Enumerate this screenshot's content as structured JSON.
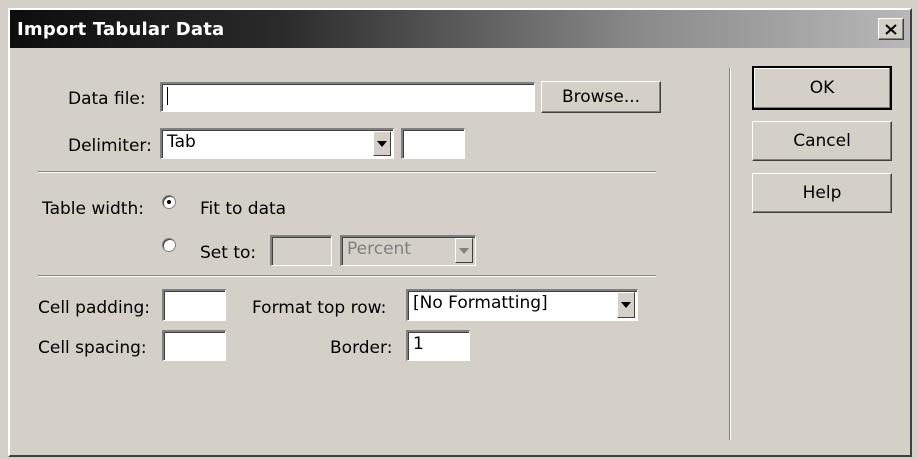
{
  "window": {
    "title": "Import Tabular Data",
    "close_label": "×"
  },
  "form": {
    "data_file": {
      "label": "Data file:",
      "value": "",
      "browse_label": "Browse..."
    },
    "delimiter": {
      "label": "Delimiter:",
      "selected": "Tab",
      "other_value": ""
    },
    "table_width": {
      "label": "Table width:",
      "fit_label": "Fit to data",
      "fit_checked": true,
      "set_label": "Set to:",
      "set_checked": false,
      "set_value": "",
      "unit_selected": "Percent"
    },
    "cell_padding": {
      "label": "Cell padding:",
      "value": ""
    },
    "cell_spacing": {
      "label": "Cell spacing:",
      "value": ""
    },
    "format_top_row": {
      "label": "Format top row:",
      "selected": "[No Formatting]"
    },
    "border": {
      "label": "Border:",
      "value": "1"
    }
  },
  "buttons": {
    "ok": "OK",
    "cancel": "Cancel",
    "help": "Help"
  }
}
